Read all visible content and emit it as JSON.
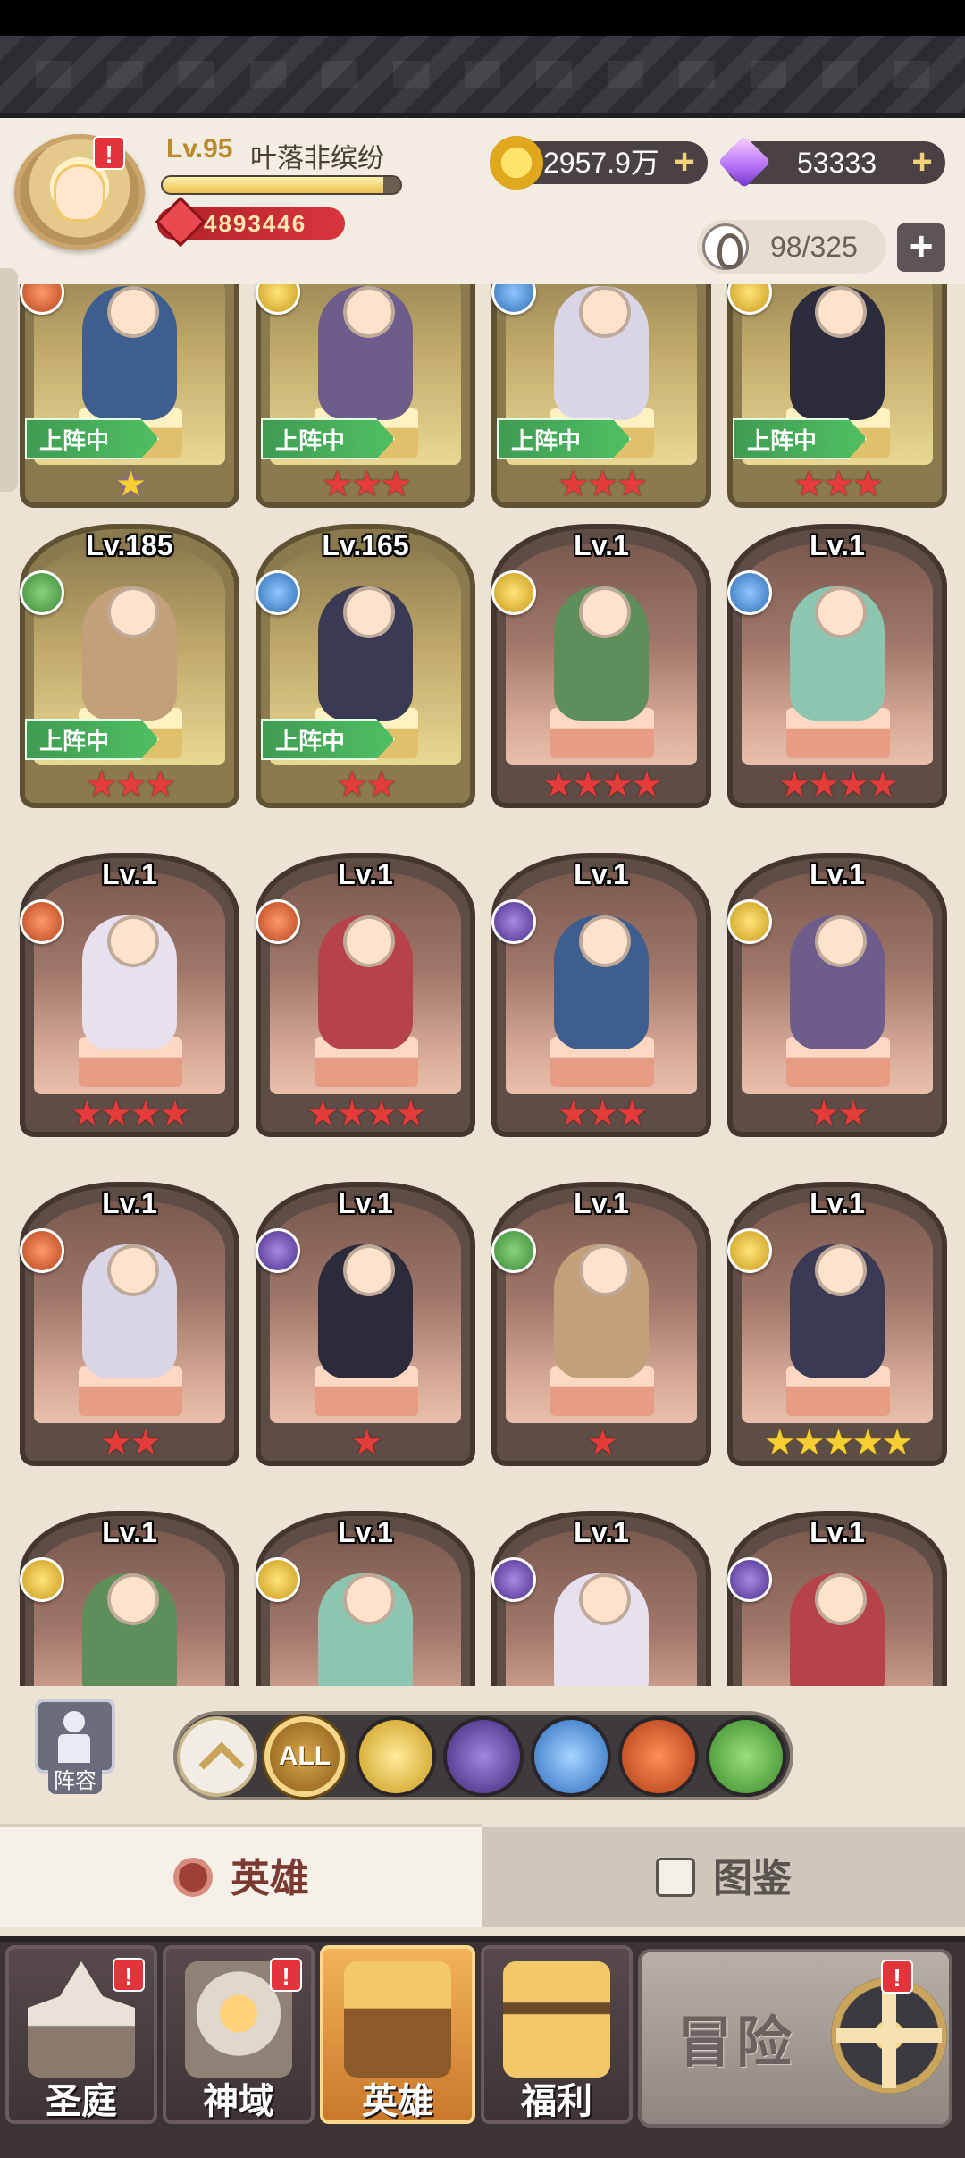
{
  "player": {
    "level": "Lv.95",
    "name": "叶落非缤纷",
    "power": "4893446",
    "xp_fraction": 0.93
  },
  "currency": {
    "gold": "2957.9万",
    "diamonds": "53333"
  },
  "roster": {
    "capacity": "98/325"
  },
  "deployed_label": "上阵中",
  "heroes": [
    {
      "level": "",
      "faction": "beast",
      "stars": "★",
      "star_color": "purple",
      "deployed": true
    },
    {
      "level": "",
      "faction": "light",
      "stars": "★★★",
      "star_color": "red",
      "deployed": true
    },
    {
      "level": "",
      "faction": "holy",
      "stars": "★★★",
      "star_color": "red",
      "deployed": true
    },
    {
      "level": "",
      "faction": "light",
      "stars": "★★★",
      "star_color": "red",
      "deployed": true
    },
    {
      "level": "Lv.185",
      "faction": "nature",
      "stars": "★★★",
      "star_color": "red",
      "deployed": true
    },
    {
      "level": "Lv.165",
      "faction": "holy",
      "stars": "★★",
      "star_color": "red",
      "deployed": true
    },
    {
      "level": "Lv.1",
      "faction": "light",
      "stars": "★★★★",
      "star_color": "red",
      "deployed": false
    },
    {
      "level": "Lv.1",
      "faction": "holy",
      "stars": "★★★★",
      "star_color": "red",
      "deployed": false
    },
    {
      "level": "Lv.1",
      "faction": "beast",
      "stars": "★★★★",
      "star_color": "red",
      "deployed": false
    },
    {
      "level": "Lv.1",
      "faction": "beast",
      "stars": "★★★★",
      "star_color": "red",
      "deployed": false
    },
    {
      "level": "Lv.1",
      "faction": "dark",
      "stars": "★★★",
      "star_color": "red",
      "deployed": false
    },
    {
      "level": "Lv.1",
      "faction": "light",
      "stars": "★★",
      "star_color": "red",
      "deployed": false
    },
    {
      "level": "Lv.1",
      "faction": "beast",
      "stars": "★★",
      "star_color": "red",
      "deployed": false
    },
    {
      "level": "Lv.1",
      "faction": "dark",
      "stars": "★",
      "star_color": "red",
      "deployed": false
    },
    {
      "level": "Lv.1",
      "faction": "nature",
      "stars": "★",
      "star_color": "red",
      "deployed": false
    },
    {
      "level": "Lv.1",
      "faction": "light",
      "stars": "★★★★★",
      "star_color": "gold",
      "deployed": false
    },
    {
      "level": "Lv.1",
      "faction": "light",
      "stars": "",
      "star_color": "red",
      "deployed": false
    },
    {
      "level": "Lv.1",
      "faction": "light",
      "stars": "",
      "star_color": "red",
      "deployed": false
    },
    {
      "level": "Lv.1",
      "faction": "dark",
      "stars": "",
      "star_color": "red",
      "deployed": false
    },
    {
      "level": "Lv.1",
      "faction": "dark",
      "stars": "",
      "star_color": "red",
      "deployed": false
    }
  ],
  "filters": {
    "lineup_label": "阵容",
    "all_label": "ALL"
  },
  "tabs": {
    "heroes": "英雄",
    "codex": "图鉴"
  },
  "nav": {
    "court": "圣庭",
    "realm": "神域",
    "hero": "英雄",
    "welfare": "福利",
    "adventure": "冒险"
  },
  "alerts": {
    "badge": "!"
  }
}
